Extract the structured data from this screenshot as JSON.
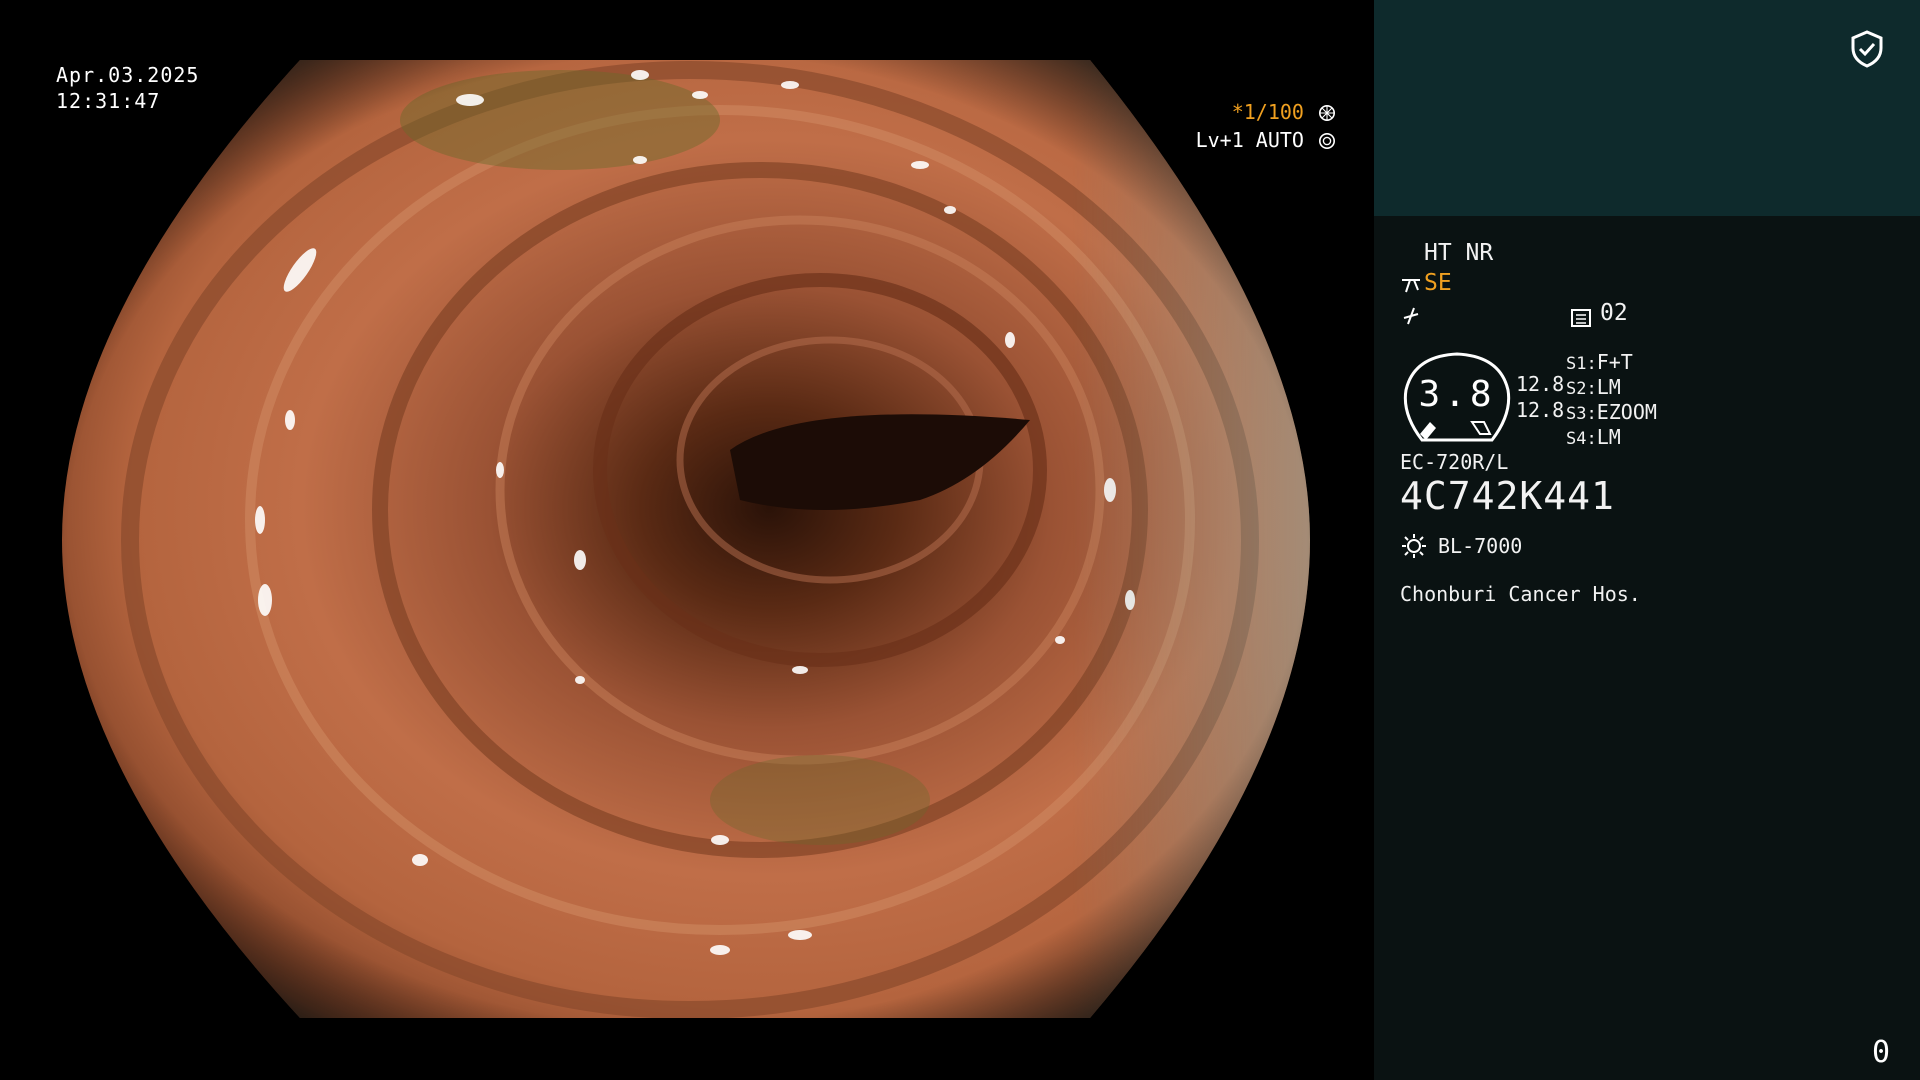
{
  "overlay": {
    "date": "Apr.03.2025",
    "time": "12:31:47",
    "shutter": "*1/100",
    "level": "Lv+1 AUTO"
  },
  "panel": {
    "mode_line": "HT NR",
    "enhance": "SE",
    "memory": "02",
    "dial_value": "3.8",
    "readout_1": "12.8",
    "readout_2": "12.8",
    "switches": [
      {
        "key": "S1:",
        "value": "F+T"
      },
      {
        "key": "S2:",
        "value": "LM"
      },
      {
        "key": "S3:",
        "value": "EZOOM"
      },
      {
        "key": "S4:",
        "value": "LM"
      }
    ],
    "scope_model": "EC-720R/L",
    "serial": "4C742K441",
    "light_source": "BL-7000",
    "institution": "Chonburi Cancer Hos.",
    "counter": "0"
  },
  "colors": {
    "accent_orange": "#f0a020",
    "panel_top": "#0e2a2c",
    "panel_bg": "#0a1212"
  },
  "icons": [
    "shield-check-icon",
    "shutter-icon",
    "iris-icon",
    "scissors-icon",
    "lightning-icon",
    "memory-icon",
    "light-bulb-icon"
  ]
}
